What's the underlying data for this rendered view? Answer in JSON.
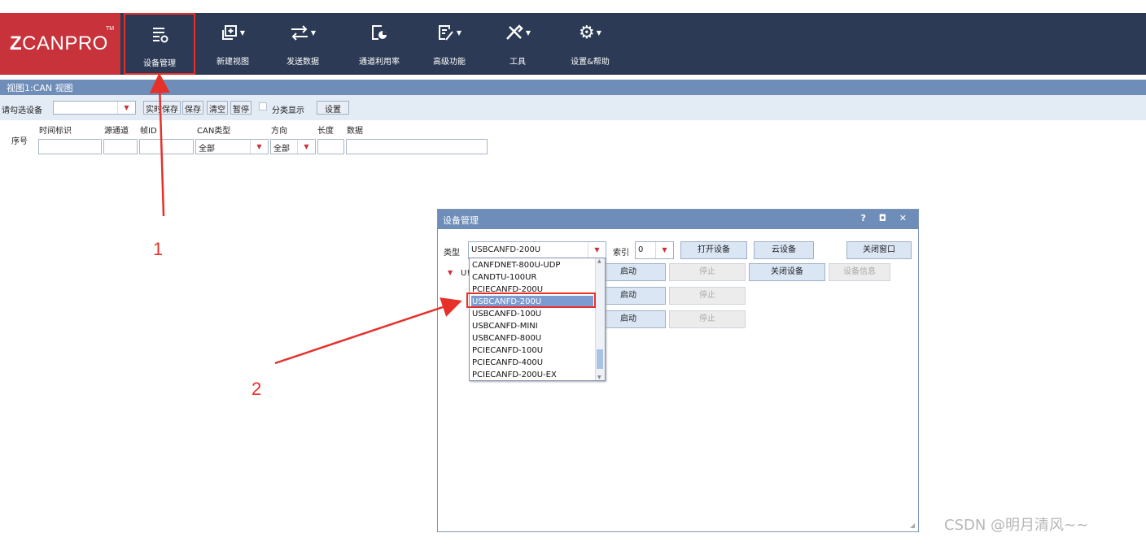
{
  "ribbon": {
    "logo_z": "Z",
    "logo_rest": "CANPRO",
    "logo_tm": "TM",
    "buttons": [
      {
        "label": "设备管理",
        "icon": "device-manage-icon"
      },
      {
        "label": "新建视图",
        "icon": "new-view-icon"
      },
      {
        "label": "发送数据",
        "icon": "send-data-icon"
      },
      {
        "label": "通道利用率",
        "icon": "channel-usage-icon"
      },
      {
        "label": "高级功能",
        "icon": "advanced-icon"
      },
      {
        "label": "工具",
        "icon": "tools-icon"
      },
      {
        "label": "设置&帮助",
        "icon": "settings-icon"
      }
    ]
  },
  "view": {
    "title": "视图1:CAN 视图",
    "select_device_label": "请勾选设备",
    "device_value": "",
    "realtime_save": "实时保存",
    "save": "保存",
    "clear": "清空",
    "pause": "暂停",
    "classify_display": "分类显示",
    "settings": "设置",
    "columns": {
      "index": "序号",
      "timestamp": "时间标识",
      "source_channel": "源通道",
      "frame_id": "帧ID",
      "can_type": "CAN类型",
      "direction": "方向",
      "length": "长度",
      "data": "数据"
    },
    "filters": {
      "can_type": "全部",
      "direction": "全部"
    }
  },
  "dialog": {
    "title": "设备管理",
    "controls": "? ◘ ✕",
    "type_label": "类型",
    "type_value": "USBCANFD-200U",
    "index_label": "索引",
    "index_value": "0",
    "open_device": "打开设备",
    "cloud_device": "云设备",
    "close_window": "关闭窗口",
    "tree_prefix": "U!",
    "rows": [
      {
        "start": "启动",
        "stop": "停止"
      },
      {
        "start": "启动",
        "stop": "停止"
      },
      {
        "start": "启动",
        "stop": "停止"
      }
    ],
    "close_device": "关闭设备",
    "device_info": "设备信息",
    "dropdown_options": [
      "CANFDNET-800U-UDP",
      "CANDTU-100UR",
      "PCIECANFD-200U",
      "USBCANFD-200U",
      "USBCANFD-100U",
      "USBCANFD-MINI",
      "USBCANFD-800U",
      "PCIECANFD-100U",
      "PCIECANFD-400U",
      "PCIECANFD-200U-EX"
    ],
    "selected_option": "USBCANFD-200U"
  },
  "annotations": {
    "step1": "1",
    "step2": "2",
    "color": "#e6302a"
  },
  "watermark": "CSDN @明月清风~~"
}
